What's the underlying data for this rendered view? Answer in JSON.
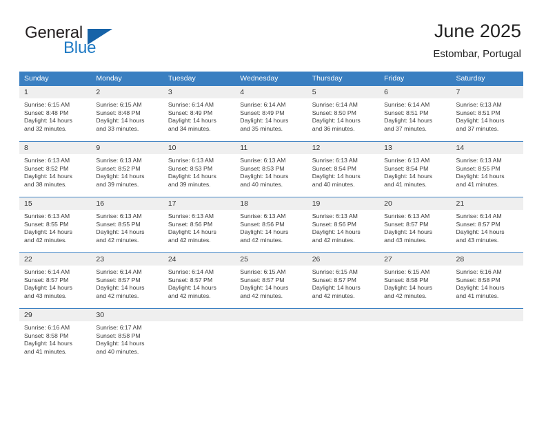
{
  "logo": {
    "word_one": "General",
    "word_two": "Blue",
    "triangle_color": "#1763a8",
    "blue_color": "#1f7ac4"
  },
  "header": {
    "title": "June 2025",
    "subtitle": "Estombar, Portugal"
  },
  "theme": {
    "header_blue": "#3a7fc1",
    "daynum_gray": "#efefef"
  },
  "weekday_headers": [
    "Sunday",
    "Monday",
    "Tuesday",
    "Wednesday",
    "Thursday",
    "Friday",
    "Saturday"
  ],
  "weeks": [
    [
      {
        "day": "1",
        "sunrise": "Sunrise: 6:15 AM",
        "sunset": "Sunset: 8:48 PM",
        "daylight_line1": "Daylight: 14 hours",
        "daylight_line2": "and 32 minutes."
      },
      {
        "day": "2",
        "sunrise": "Sunrise: 6:15 AM",
        "sunset": "Sunset: 8:48 PM",
        "daylight_line1": "Daylight: 14 hours",
        "daylight_line2": "and 33 minutes."
      },
      {
        "day": "3",
        "sunrise": "Sunrise: 6:14 AM",
        "sunset": "Sunset: 8:49 PM",
        "daylight_line1": "Daylight: 14 hours",
        "daylight_line2": "and 34 minutes."
      },
      {
        "day": "4",
        "sunrise": "Sunrise: 6:14 AM",
        "sunset": "Sunset: 8:49 PM",
        "daylight_line1": "Daylight: 14 hours",
        "daylight_line2": "and 35 minutes."
      },
      {
        "day": "5",
        "sunrise": "Sunrise: 6:14 AM",
        "sunset": "Sunset: 8:50 PM",
        "daylight_line1": "Daylight: 14 hours",
        "daylight_line2": "and 36 minutes."
      },
      {
        "day": "6",
        "sunrise": "Sunrise: 6:14 AM",
        "sunset": "Sunset: 8:51 PM",
        "daylight_line1": "Daylight: 14 hours",
        "daylight_line2": "and 37 minutes."
      },
      {
        "day": "7",
        "sunrise": "Sunrise: 6:13 AM",
        "sunset": "Sunset: 8:51 PM",
        "daylight_line1": "Daylight: 14 hours",
        "daylight_line2": "and 37 minutes."
      }
    ],
    [
      {
        "day": "8",
        "sunrise": "Sunrise: 6:13 AM",
        "sunset": "Sunset: 8:52 PM",
        "daylight_line1": "Daylight: 14 hours",
        "daylight_line2": "and 38 minutes."
      },
      {
        "day": "9",
        "sunrise": "Sunrise: 6:13 AM",
        "sunset": "Sunset: 8:52 PM",
        "daylight_line1": "Daylight: 14 hours",
        "daylight_line2": "and 39 minutes."
      },
      {
        "day": "10",
        "sunrise": "Sunrise: 6:13 AM",
        "sunset": "Sunset: 8:53 PM",
        "daylight_line1": "Daylight: 14 hours",
        "daylight_line2": "and 39 minutes."
      },
      {
        "day": "11",
        "sunrise": "Sunrise: 6:13 AM",
        "sunset": "Sunset: 8:53 PM",
        "daylight_line1": "Daylight: 14 hours",
        "daylight_line2": "and 40 minutes."
      },
      {
        "day": "12",
        "sunrise": "Sunrise: 6:13 AM",
        "sunset": "Sunset: 8:54 PM",
        "daylight_line1": "Daylight: 14 hours",
        "daylight_line2": "and 40 minutes."
      },
      {
        "day": "13",
        "sunrise": "Sunrise: 6:13 AM",
        "sunset": "Sunset: 8:54 PM",
        "daylight_line1": "Daylight: 14 hours",
        "daylight_line2": "and 41 minutes."
      },
      {
        "day": "14",
        "sunrise": "Sunrise: 6:13 AM",
        "sunset": "Sunset: 8:55 PM",
        "daylight_line1": "Daylight: 14 hours",
        "daylight_line2": "and 41 minutes."
      }
    ],
    [
      {
        "day": "15",
        "sunrise": "Sunrise: 6:13 AM",
        "sunset": "Sunset: 8:55 PM",
        "daylight_line1": "Daylight: 14 hours",
        "daylight_line2": "and 42 minutes."
      },
      {
        "day": "16",
        "sunrise": "Sunrise: 6:13 AM",
        "sunset": "Sunset: 8:55 PM",
        "daylight_line1": "Daylight: 14 hours",
        "daylight_line2": "and 42 minutes."
      },
      {
        "day": "17",
        "sunrise": "Sunrise: 6:13 AM",
        "sunset": "Sunset: 8:56 PM",
        "daylight_line1": "Daylight: 14 hours",
        "daylight_line2": "and 42 minutes."
      },
      {
        "day": "18",
        "sunrise": "Sunrise: 6:13 AM",
        "sunset": "Sunset: 8:56 PM",
        "daylight_line1": "Daylight: 14 hours",
        "daylight_line2": "and 42 minutes."
      },
      {
        "day": "19",
        "sunrise": "Sunrise: 6:13 AM",
        "sunset": "Sunset: 8:56 PM",
        "daylight_line1": "Daylight: 14 hours",
        "daylight_line2": "and 42 minutes."
      },
      {
        "day": "20",
        "sunrise": "Sunrise: 6:13 AM",
        "sunset": "Sunset: 8:57 PM",
        "daylight_line1": "Daylight: 14 hours",
        "daylight_line2": "and 43 minutes."
      },
      {
        "day": "21",
        "sunrise": "Sunrise: 6:14 AM",
        "sunset": "Sunset: 8:57 PM",
        "daylight_line1": "Daylight: 14 hours",
        "daylight_line2": "and 43 minutes."
      }
    ],
    [
      {
        "day": "22",
        "sunrise": "Sunrise: 6:14 AM",
        "sunset": "Sunset: 8:57 PM",
        "daylight_line1": "Daylight: 14 hours",
        "daylight_line2": "and 43 minutes."
      },
      {
        "day": "23",
        "sunrise": "Sunrise: 6:14 AM",
        "sunset": "Sunset: 8:57 PM",
        "daylight_line1": "Daylight: 14 hours",
        "daylight_line2": "and 42 minutes."
      },
      {
        "day": "24",
        "sunrise": "Sunrise: 6:14 AM",
        "sunset": "Sunset: 8:57 PM",
        "daylight_line1": "Daylight: 14 hours",
        "daylight_line2": "and 42 minutes."
      },
      {
        "day": "25",
        "sunrise": "Sunrise: 6:15 AM",
        "sunset": "Sunset: 8:57 PM",
        "daylight_line1": "Daylight: 14 hours",
        "daylight_line2": "and 42 minutes."
      },
      {
        "day": "26",
        "sunrise": "Sunrise: 6:15 AM",
        "sunset": "Sunset: 8:57 PM",
        "daylight_line1": "Daylight: 14 hours",
        "daylight_line2": "and 42 minutes."
      },
      {
        "day": "27",
        "sunrise": "Sunrise: 6:15 AM",
        "sunset": "Sunset: 8:58 PM",
        "daylight_line1": "Daylight: 14 hours",
        "daylight_line2": "and 42 minutes."
      },
      {
        "day": "28",
        "sunrise": "Sunrise: 6:16 AM",
        "sunset": "Sunset: 8:58 PM",
        "daylight_line1": "Daylight: 14 hours",
        "daylight_line2": "and 41 minutes."
      }
    ],
    [
      {
        "day": "29",
        "sunrise": "Sunrise: 6:16 AM",
        "sunset": "Sunset: 8:58 PM",
        "daylight_line1": "Daylight: 14 hours",
        "daylight_line2": "and 41 minutes."
      },
      {
        "day": "30",
        "sunrise": "Sunrise: 6:17 AM",
        "sunset": "Sunset: 8:58 PM",
        "daylight_line1": "Daylight: 14 hours",
        "daylight_line2": "and 40 minutes."
      },
      {
        "day": "",
        "sunrise": "",
        "sunset": "",
        "daylight_line1": "",
        "daylight_line2": ""
      },
      {
        "day": "",
        "sunrise": "",
        "sunset": "",
        "daylight_line1": "",
        "daylight_line2": ""
      },
      {
        "day": "",
        "sunrise": "",
        "sunset": "",
        "daylight_line1": "",
        "daylight_line2": ""
      },
      {
        "day": "",
        "sunrise": "",
        "sunset": "",
        "daylight_line1": "",
        "daylight_line2": ""
      },
      {
        "day": "",
        "sunrise": "",
        "sunset": "",
        "daylight_line1": "",
        "daylight_line2": ""
      }
    ]
  ]
}
